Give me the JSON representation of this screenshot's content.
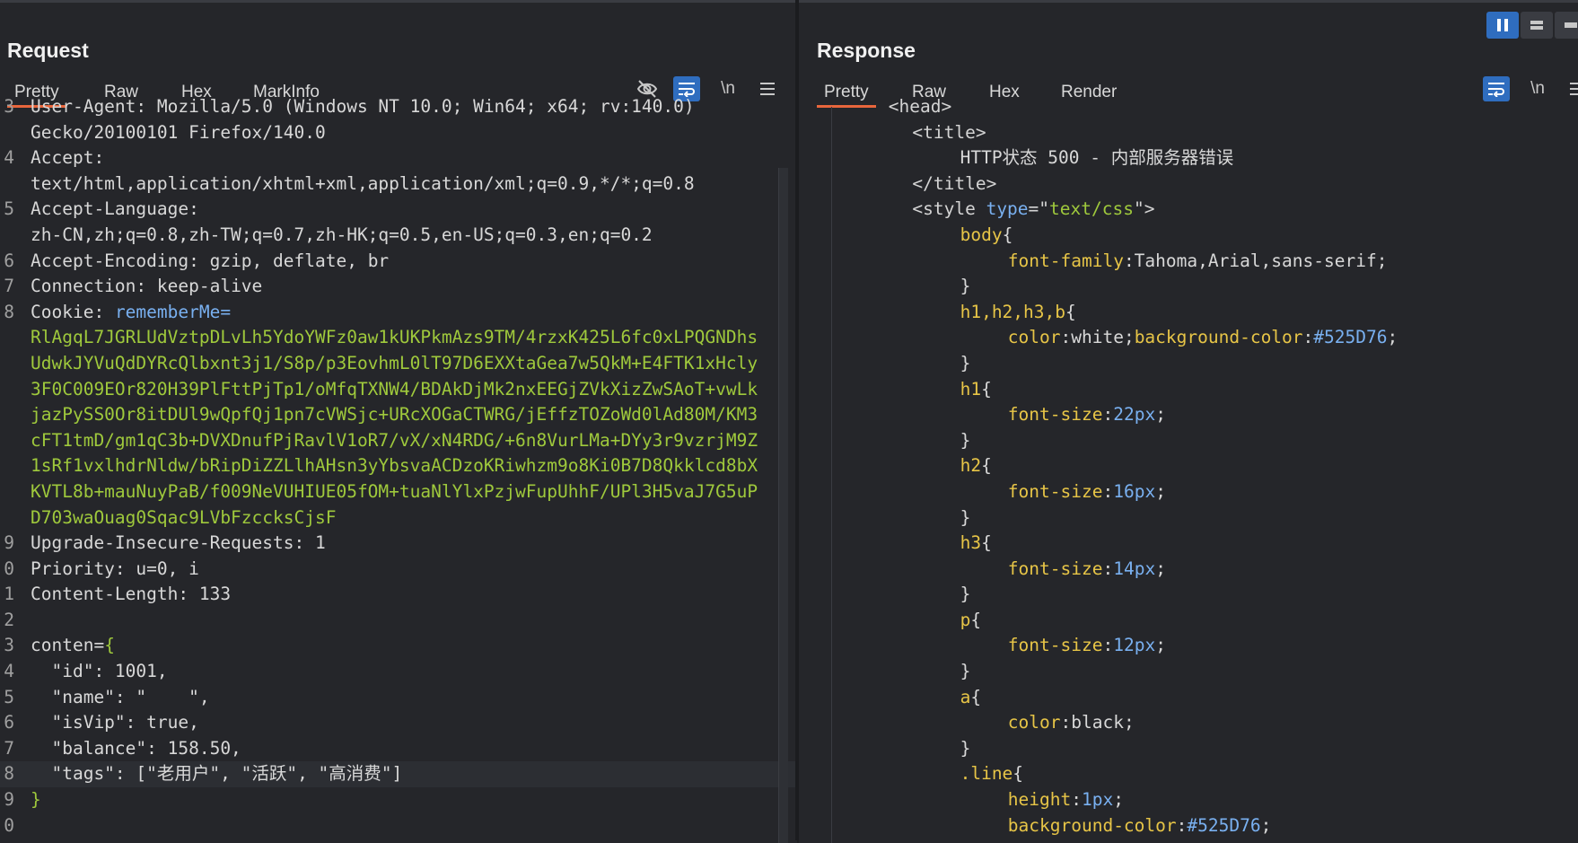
{
  "request": {
    "title": "Request",
    "tabs": [
      "Pretty",
      "Raw",
      "Hex",
      "MarkInfo"
    ],
    "active_tab": "Pretty",
    "lines": [
      {
        "n": "3",
        "parts": [
          {
            "t": "User-Agent: Mozilla/5.0 (Windows NT 10.0; Win64; x64; rv:140.0)",
            "c": "k"
          }
        ]
      },
      {
        "n": "",
        "parts": [
          {
            "t": "Gecko/20100101 Firefox/140.0",
            "c": "v"
          }
        ]
      },
      {
        "n": "4",
        "parts": [
          {
            "t": "Accept:",
            "c": "k"
          }
        ]
      },
      {
        "n": "",
        "parts": [
          {
            "t": "text/html,application/xhtml+xml,application/xml;q=0.9,*/*;q=0.8",
            "c": "v"
          }
        ]
      },
      {
        "n": "5",
        "parts": [
          {
            "t": "Accept-Language:",
            "c": "k"
          }
        ]
      },
      {
        "n": "",
        "parts": [
          {
            "t": "zh-CN,zh;q=0.8,zh-TW;q=0.7,zh-HK;q=0.5,en-US;q=0.3,en;q=0.2",
            "c": "v"
          }
        ]
      },
      {
        "n": "6",
        "parts": [
          {
            "t": "Accept-Encoding",
            "c": "k"
          },
          {
            "t": ": gzip, deflate, br",
            "c": "v"
          }
        ]
      },
      {
        "n": "7",
        "parts": [
          {
            "t": "Connection",
            "c": "k"
          },
          {
            "t": ": keep-alive",
            "c": "v"
          }
        ]
      },
      {
        "n": "8",
        "parts": [
          {
            "t": "Cookie",
            "c": "k"
          },
          {
            "t": ": ",
            "c": "v"
          },
          {
            "t": "rememberMe=",
            "c": "sel"
          }
        ]
      },
      {
        "n": "",
        "parts": [
          {
            "t": "RlAgqL7JGRLUdVztpDLvLh5YdoYWFz0aw1kUKPkmAzs9TM/4rzxK425L6fc0xLPQGNDhs",
            "c": "g"
          }
        ]
      },
      {
        "n": "",
        "parts": [
          {
            "t": "UdwkJYVuQdDYRcQlbxnt3j1/S8p/p3EovhmL0lT97D6EXXtaGea7w5QkM+E4FTK1xHcly",
            "c": "g"
          }
        ]
      },
      {
        "n": "",
        "parts": [
          {
            "t": "3F0C009EOr820H39PlFttPjTp1/oMfqTXNW4/BDAkDjMk2nxEEGjZVkXizZwSAoT+vwLk",
            "c": "g"
          }
        ]
      },
      {
        "n": "",
        "parts": [
          {
            "t": "jazPySS0Or8itDUl9wQpfQj1pn7cVWSjc+URcXOGaCTWRG/jEffzTOZoWd0lAd80M/KM3",
            "c": "g"
          }
        ]
      },
      {
        "n": "",
        "parts": [
          {
            "t": "cFT1tmD/gm1qC3b+DVXDnufPjRavlV1oR7/vX/xN4RDG/+6n8VurLMa+DYy3r9vzrjM9Z",
            "c": "g"
          }
        ]
      },
      {
        "n": "",
        "parts": [
          {
            "t": "1sRf1vxlhdrNldw/bRipDiZZLlhAHsn3yYbsvaACDzoKRiwhzm9o8Ki0B7D8Qkklcd8bX",
            "c": "g"
          }
        ]
      },
      {
        "n": "",
        "parts": [
          {
            "t": "KVTL8b+mauNuyPaB/f009NeVUHIUE05fOM+tuaNlYlxPzjwFupUhhF/UPl3H5vaJ7G5uP",
            "c": "g"
          }
        ]
      },
      {
        "n": "",
        "parts": [
          {
            "t": "D703waOuag0Sqac9LVbFzccksCjsF",
            "c": "g"
          }
        ]
      },
      {
        "n": "9",
        "parts": [
          {
            "t": "Upgrade-Insecure-Requests",
            "c": "k"
          },
          {
            "t": ": 1",
            "c": "v"
          }
        ]
      },
      {
        "n": "0",
        "parts": [
          {
            "t": "Priority",
            "c": "k"
          },
          {
            "t": ": u=0, i",
            "c": "v"
          }
        ]
      },
      {
        "n": "1",
        "parts": [
          {
            "t": "Content-Length",
            "c": "k"
          },
          {
            "t": ": 133",
            "c": "v"
          }
        ]
      },
      {
        "n": "2",
        "parts": [
          {
            "t": "",
            "c": "v"
          }
        ]
      },
      {
        "n": "3",
        "parts": [
          {
            "t": "conten=",
            "c": "k"
          },
          {
            "t": "{",
            "c": "g"
          }
        ]
      },
      {
        "n": "4",
        "parts": [
          {
            "t": "  \"id\": 1001,",
            "c": "v"
          }
        ]
      },
      {
        "n": "5",
        "parts": [
          {
            "t": "  \"name\": \"    \",",
            "c": "v"
          }
        ]
      },
      {
        "n": "6",
        "parts": [
          {
            "t": "  \"isVip\": true,",
            "c": "v"
          }
        ]
      },
      {
        "n": "7",
        "parts": [
          {
            "t": "  \"balance\": 158.50,",
            "c": "v"
          }
        ]
      },
      {
        "n": "8",
        "parts": [
          {
            "t": "  \"tags\": [\"老用户\", \"活跃\", \"高消费\"]",
            "c": "v"
          }
        ],
        "hl": true
      },
      {
        "n": "9",
        "parts": [
          {
            "t": "}",
            "c": "g"
          }
        ]
      },
      {
        "n": "0",
        "parts": [
          {
            "t": "",
            "c": "v"
          }
        ]
      }
    ]
  },
  "response": {
    "title": "Response",
    "tabs": [
      "Pretty",
      "Raw",
      "Hex",
      "Render"
    ],
    "active_tab": "Pretty",
    "lines": [
      {
        "i": 6,
        "parts": [
          {
            "t": "<head>",
            "c": "tag"
          }
        ]
      },
      {
        "i": 8,
        "parts": [
          {
            "t": "<title>",
            "c": "tag"
          }
        ]
      },
      {
        "i": 12,
        "parts": [
          {
            "t": "HTTP状态 500 - 内部服务器错误",
            "c": "val"
          }
        ]
      },
      {
        "i": 8,
        "parts": [
          {
            "t": "</title>",
            "c": "tag"
          }
        ]
      },
      {
        "i": 8,
        "parts": [
          {
            "t": "<style ",
            "c": "tag"
          },
          {
            "t": "type",
            "c": "attr"
          },
          {
            "t": "=\"",
            "c": "tag"
          },
          {
            "t": "text/css",
            "c": "str"
          },
          {
            "t": "\">",
            "c": "tag"
          }
        ]
      },
      {
        "i": 12,
        "parts": [
          {
            "t": "body",
            "c": "cls"
          },
          {
            "t": "{",
            "c": "val"
          }
        ]
      },
      {
        "i": 16,
        "parts": [
          {
            "t": "font-family",
            "c": "prop"
          },
          {
            "t": ":Tahoma,Arial,sans-serif;",
            "c": "val"
          }
        ]
      },
      {
        "i": 12,
        "parts": [
          {
            "t": "}",
            "c": "val"
          }
        ]
      },
      {
        "i": 12,
        "parts": [
          {
            "t": "h1,h2,h3,b",
            "c": "cls"
          },
          {
            "t": "{",
            "c": "val"
          }
        ]
      },
      {
        "i": 16,
        "parts": [
          {
            "t": "color",
            "c": "prop"
          },
          {
            "t": ":white;",
            "c": "val"
          },
          {
            "t": "background-color",
            "c": "prop"
          },
          {
            "t": ":",
            "c": "val"
          },
          {
            "t": "#525D76",
            "c": "hex"
          },
          {
            "t": ";",
            "c": "val"
          }
        ]
      },
      {
        "i": 12,
        "parts": [
          {
            "t": "}",
            "c": "val"
          }
        ]
      },
      {
        "i": 12,
        "parts": [
          {
            "t": "h1",
            "c": "cls"
          },
          {
            "t": "{",
            "c": "val"
          }
        ]
      },
      {
        "i": 16,
        "parts": [
          {
            "t": "font-size",
            "c": "prop"
          },
          {
            "t": ":",
            "c": "val"
          },
          {
            "t": "22px",
            "c": "hex"
          },
          {
            "t": ";",
            "c": "val"
          }
        ]
      },
      {
        "i": 12,
        "parts": [
          {
            "t": "}",
            "c": "val"
          }
        ]
      },
      {
        "i": 12,
        "parts": [
          {
            "t": "h2",
            "c": "cls"
          },
          {
            "t": "{",
            "c": "val"
          }
        ]
      },
      {
        "i": 16,
        "parts": [
          {
            "t": "font-size",
            "c": "prop"
          },
          {
            "t": ":",
            "c": "val"
          },
          {
            "t": "16px",
            "c": "hex"
          },
          {
            "t": ";",
            "c": "val"
          }
        ]
      },
      {
        "i": 12,
        "parts": [
          {
            "t": "}",
            "c": "val"
          }
        ]
      },
      {
        "i": 12,
        "parts": [
          {
            "t": "h3",
            "c": "cls"
          },
          {
            "t": "{",
            "c": "val"
          }
        ]
      },
      {
        "i": 16,
        "parts": [
          {
            "t": "font-size",
            "c": "prop"
          },
          {
            "t": ":",
            "c": "val"
          },
          {
            "t": "14px",
            "c": "hex"
          },
          {
            "t": ";",
            "c": "val"
          }
        ]
      },
      {
        "i": 12,
        "parts": [
          {
            "t": "}",
            "c": "val"
          }
        ]
      },
      {
        "i": 12,
        "parts": [
          {
            "t": "p",
            "c": "cls"
          },
          {
            "t": "{",
            "c": "val"
          }
        ]
      },
      {
        "i": 16,
        "parts": [
          {
            "t": "font-size",
            "c": "prop"
          },
          {
            "t": ":",
            "c": "val"
          },
          {
            "t": "12px",
            "c": "hex"
          },
          {
            "t": ";",
            "c": "val"
          }
        ]
      },
      {
        "i": 12,
        "parts": [
          {
            "t": "}",
            "c": "val"
          }
        ]
      },
      {
        "i": 12,
        "parts": [
          {
            "t": "a",
            "c": "cls"
          },
          {
            "t": "{",
            "c": "val"
          }
        ]
      },
      {
        "i": 16,
        "parts": [
          {
            "t": "color",
            "c": "prop"
          },
          {
            "t": ":black;",
            "c": "val"
          }
        ]
      },
      {
        "i": 12,
        "parts": [
          {
            "t": "}",
            "c": "val"
          }
        ]
      },
      {
        "i": 12,
        "parts": [
          {
            "t": ".line",
            "c": "cls"
          },
          {
            "t": "{",
            "c": "val"
          }
        ]
      },
      {
        "i": 16,
        "parts": [
          {
            "t": "height",
            "c": "prop"
          },
          {
            "t": ":",
            "c": "val"
          },
          {
            "t": "1px",
            "c": "hex"
          },
          {
            "t": ";",
            "c": "val"
          }
        ]
      },
      {
        "i": 16,
        "parts": [
          {
            "t": "background-color",
            "c": "prop"
          },
          {
            "t": ":",
            "c": "val"
          },
          {
            "t": "#525D76",
            "c": "hex"
          },
          {
            "t": ";",
            "c": "val"
          }
        ]
      }
    ]
  },
  "toolbar": {
    "hide_icon": "eye-off-icon",
    "wrap_icon": "wrap-icon",
    "newline_label": "\\n",
    "menu_icon": "menu-icon"
  }
}
